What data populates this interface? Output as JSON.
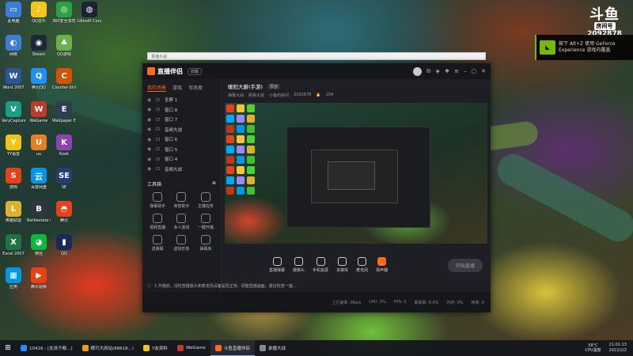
{
  "desktop_icons": [
    {
      "label": "此电脑",
      "color": "#3b7dd8",
      "glyph": "▭"
    },
    {
      "label": "QQ音乐",
      "color": "#f5c518",
      "glyph": "♪"
    },
    {
      "label": "360安全浏览器",
      "color": "#2ea043",
      "glyph": "◎"
    },
    {
      "label": "Ubisoft Connect",
      "color": "#1c2333",
      "glyph": "◍"
    },
    {
      "label": "网络",
      "color": "#3b7dd8",
      "glyph": "◐"
    },
    {
      "label": "Steam",
      "color": "#1b2838",
      "glyph": "◉"
    },
    {
      "label": "QQ游戏",
      "color": "#6ab04c",
      "glyph": "♣"
    },
    {
      "label": "回收站",
      "color": "#7f8c8d",
      "glyph": "▤"
    },
    {
      "label": "Word 2007",
      "color": "#2b579a",
      "glyph": "W"
    },
    {
      "label": "腾讯QQ",
      "color": "#1e90ff",
      "glyph": "Q"
    },
    {
      "label": "Counter-Strike Global Off.",
      "color": "#d35400",
      "glyph": "C"
    },
    {
      "label": "斗鱼直播",
      "color": "#ff6a1a",
      "glyph": "鱼"
    },
    {
      "label": "VeryCapture",
      "color": "#16a085",
      "glyph": "V"
    },
    {
      "label": "WeGame",
      "color": "#c0392b",
      "glyph": "W"
    },
    {
      "label": "Wallpaper Engine",
      "color": "#2c3e50",
      "glyph": "E"
    },
    {
      "label": "斗鱼直播伴侣",
      "color": "#ff8c1a",
      "glyph": "直"
    },
    {
      "label": "YY语音",
      "color": "#f1c40f",
      "glyph": "Y"
    },
    {
      "label": "uu",
      "color": "#e67e22",
      "glyph": "U"
    },
    {
      "label": "Kook",
      "color": "#8e44ad",
      "glyph": "K"
    },
    {
      "label": "入职游戏",
      "color": "#34495e",
      "glyph": "I"
    },
    {
      "label": "搜狗",
      "color": "#e84118",
      "glyph": "S"
    },
    {
      "label": "百度网盘",
      "color": "#0097e6",
      "glyph": "云"
    },
    {
      "label": "SE",
      "color": "#273c75",
      "glyph": "SE"
    },
    {
      "label": "英雄联盟",
      "color": "#c23616",
      "glyph": "拓"
    },
    {
      "label": "英雄联盟",
      "color": "#e1b12c",
      "glyph": "L"
    },
    {
      "label": "Battlestate Games L.",
      "color": "#2f3640",
      "glyph": "B"
    },
    {
      "label": "腾讯",
      "color": "#e84118",
      "glyph": "◓"
    },
    {
      "label": "火绒",
      "color": "#fbc531",
      "glyph": "▲"
    },
    {
      "label": "Excel 2007",
      "color": "#217346",
      "glyph": "X"
    },
    {
      "label": "微信",
      "color": "#09b83e",
      "glyph": "◕"
    },
    {
      "label": "QQ",
      "color": "#192a56",
      "glyph": "▮"
    },
    {
      "label": "GeForce Experience",
      "color": "#76b900",
      "glyph": "N"
    },
    {
      "label": "应用",
      "color": "#0097e6",
      "glyph": "▦"
    },
    {
      "label": "腾讯视频",
      "color": "#e84118",
      "glyph": "▶"
    }
  ],
  "douyu": {
    "logo_text": "斗鱼",
    "room_label": "房间号",
    "room_number": "2092878"
  },
  "nvidia_toast": {
    "line1": "按下 Alt+Z 使用 GeForce",
    "line2": "Experience 游戏内覆盖"
  },
  "browser_bar": {
    "text": "录播大战"
  },
  "app": {
    "title": "直播伴侣",
    "version": "旧版",
    "sidebar_tabs": [
      "我的场景",
      "游戏",
      "可改类"
    ],
    "scenes": [
      "全屏 1",
      "窗口 8",
      "窗口 7",
      "音频大战",
      "窗口 6",
      "窗口 5",
      "窗口 4",
      "音频大战"
    ],
    "tools_title": "工具箱",
    "tools": [
      "弹幕助手",
      "房管助手",
      "主播任务",
      "视频直播",
      "多人连线",
      "一键开播",
      "送弹幕",
      "虚拟形象",
      "弹幕库"
    ],
    "room_title": "暖阳大爵(手游)",
    "room_tag": "原创",
    "room_category": "弹幕大战",
    "room_sub_label": "网易大战",
    "room_id_label": "小鱼的房间",
    "room_id": "2092878",
    "hot_count": "154",
    "controls": [
      {
        "label": "直播弹幕",
        "active": false
      },
      {
        "label": "摄像头",
        "active": false
      },
      {
        "label": "手机投屏",
        "active": false
      },
      {
        "label": "多媒体",
        "active": false
      },
      {
        "label": "麦克风",
        "active": false
      },
      {
        "label": "扬声器",
        "active": true
      }
    ],
    "start_label": "开始直播",
    "notice": "1.开播前，请检查摄像头和麦克风设备是否正常，调整直播画面，建议检查一遍…",
    "status": [
      "上行速率: 0Kb/s",
      "CPU: 0%",
      "FPS: 0",
      "丢帧率: 0.0%",
      "内存: 0%",
      "帧率: 0"
    ]
  },
  "taskbar": {
    "items": [
      {
        "label": "10416 - [女孩子都...]",
        "color": "#1e90ff",
        "active": false
      },
      {
        "label": "横可大网站(88618...)",
        "color": "#f39c12",
        "active": false
      },
      {
        "label": "Y友资料",
        "color": "#f1c40f",
        "active": false
      },
      {
        "label": "WeGame",
        "color": "#c0392b",
        "active": false
      },
      {
        "label": "斗鱼直播伴侣",
        "color": "#ff6a1a",
        "active": true
      },
      {
        "label": "录播大战",
        "color": "#7f8c8d",
        "active": false
      }
    ],
    "cpu_temp": "58°C",
    "cpu_label": "CPU温度",
    "time": "21:01:13",
    "date": "2022/2/2"
  }
}
